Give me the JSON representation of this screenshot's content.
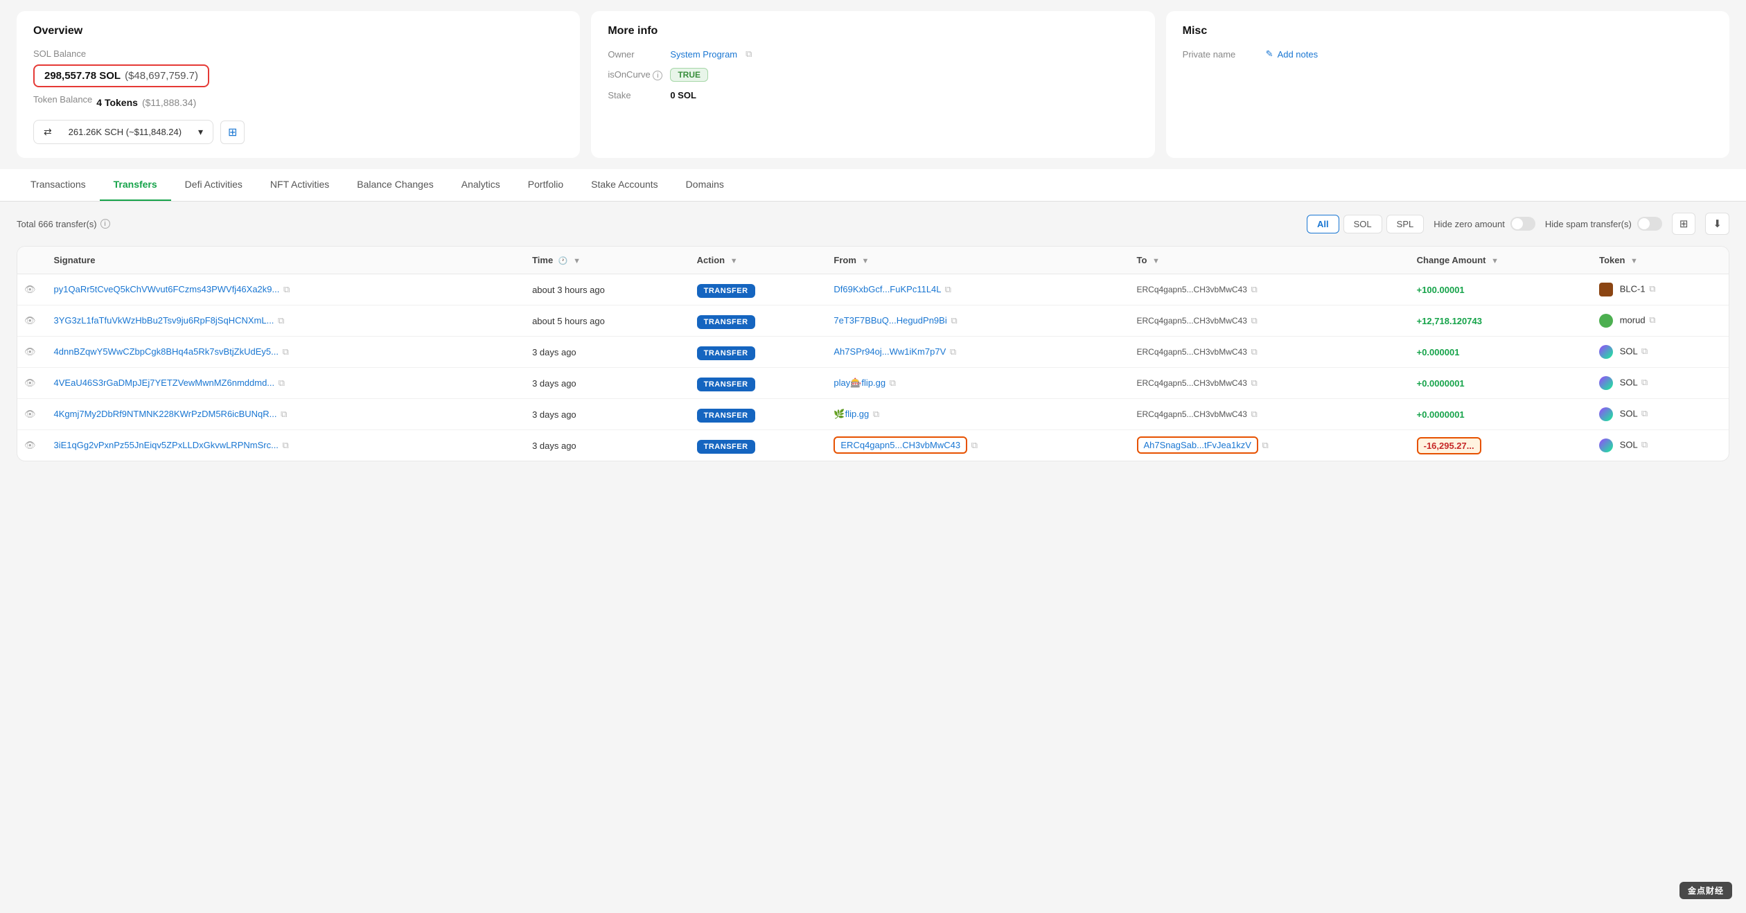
{
  "overview": {
    "title": "Overview",
    "sol_balance_label": "SOL Balance",
    "sol_balance": "298,557.78 SOL",
    "sol_balance_usd": "($48,697,759.7)",
    "token_balance_label": "Token Balance",
    "token_balance": "4 Tokens",
    "token_balance_usd": "($11,888.34)",
    "token_dropdown": "261.26K SCH (~$11,848.24)"
  },
  "more_info": {
    "title": "More info",
    "owner_label": "Owner",
    "owner_value": "System Program",
    "isoncurve_label": "isOnCurve",
    "isoncurve_value": "TRUE",
    "stake_label": "Stake",
    "stake_value": "0 SOL"
  },
  "misc": {
    "title": "Misc",
    "private_name_label": "Private name",
    "add_notes_label": "Add notes"
  },
  "tabs": [
    {
      "label": "Transactions",
      "active": false
    },
    {
      "label": "Transfers",
      "active": true
    },
    {
      "label": "Defi Activities",
      "active": false
    },
    {
      "label": "NFT Activities",
      "active": false
    },
    {
      "label": "Balance Changes",
      "active": false
    },
    {
      "label": "Analytics",
      "active": false
    },
    {
      "label": "Portfolio",
      "active": false
    },
    {
      "label": "Stake Accounts",
      "active": false
    },
    {
      "label": "Domains",
      "active": false
    }
  ],
  "transfers": {
    "total_text": "Total 666 transfer(s)",
    "filter_all": "All",
    "filter_sol": "SOL",
    "filter_spl": "SPL",
    "hide_zero_label": "Hide zero amount",
    "hide_spam_label": "Hide spam transfer(s)",
    "columns": {
      "signature": "Signature",
      "time": "Time",
      "action": "Action",
      "from": "From",
      "to": "To",
      "change_amount": "Change Amount",
      "token": "Token"
    },
    "rows": [
      {
        "signature": "py1QaRr5tCveQ5kChVWvut6FCzms43PWVfj46Xa2k9...",
        "time": "about 3 hours ago",
        "action": "TRANSFER",
        "from": "Df69KxbGcf...FuKPc11L4L",
        "to": "ERCq4gapn5...CH3vbMwC43",
        "change_amount": "+100.00001",
        "token": "BLC-1",
        "amount_type": "pos",
        "highlighted_from": false,
        "highlighted_amount": false
      },
      {
        "signature": "3YG3zL1faTfuVkWzHbBu2Tsv9ju6RpF8jSqHCNXmL...",
        "time": "about 5 hours ago",
        "action": "TRANSFER",
        "from": "7eT3F7BBuQ...HegudPn9Bi",
        "to": "ERCq4gapn5...CH3vbMwC43",
        "change_amount": "+12,718.120743",
        "token": "morud",
        "amount_type": "pos",
        "highlighted_from": false,
        "highlighted_amount": false
      },
      {
        "signature": "4dnnBZqwY5WwCZbpCgk8BHq4a5Rk7svBtjZkUdEy5...",
        "time": "3 days ago",
        "action": "TRANSFER",
        "from": "Ah7SPr94oj...Ww1iKm7p7V",
        "to": "ERCq4gapn5...CH3vbMwC43",
        "change_amount": "+0.000001",
        "token": "SOL",
        "amount_type": "pos",
        "highlighted_from": false,
        "highlighted_amount": false
      },
      {
        "signature": "4VEaU46S3rGaDMpJEj7YETZVewMwnMZ6nmddmd...",
        "time": "3 days ago",
        "action": "TRANSFER",
        "from": "play🎰flip.gg",
        "to": "ERCq4gapn5...CH3vbMwC43",
        "change_amount": "+0.0000001",
        "token": "SOL",
        "amount_type": "pos",
        "highlighted_from": false,
        "highlighted_amount": false
      },
      {
        "signature": "4Kgmj7My2DbRf9NTMNK228KWrPzDM5R6icBUNqR...",
        "time": "3 days ago",
        "action": "TRANSFER",
        "from": "🌿flip.gg",
        "to": "ERCq4gapn5...CH3vbMwC43",
        "change_amount": "+0.0000001",
        "token": "SOL",
        "amount_type": "pos",
        "highlighted_from": false,
        "highlighted_amount": false
      },
      {
        "signature": "3iE1qGg2vPxnPz55JnEiqv5ZPxLLDxGkvwLRPNmSrc...",
        "time": "3 days ago",
        "action": "TRANSFER",
        "from": "ERCq4gapn5...CH3vbMwC43",
        "to": "Ah7SnagSab...tFvJea1kzV",
        "change_amount": "-16,295.27...",
        "token": "SOL",
        "amount_type": "neg",
        "highlighted_from": true,
        "highlighted_amount": true
      }
    ]
  }
}
